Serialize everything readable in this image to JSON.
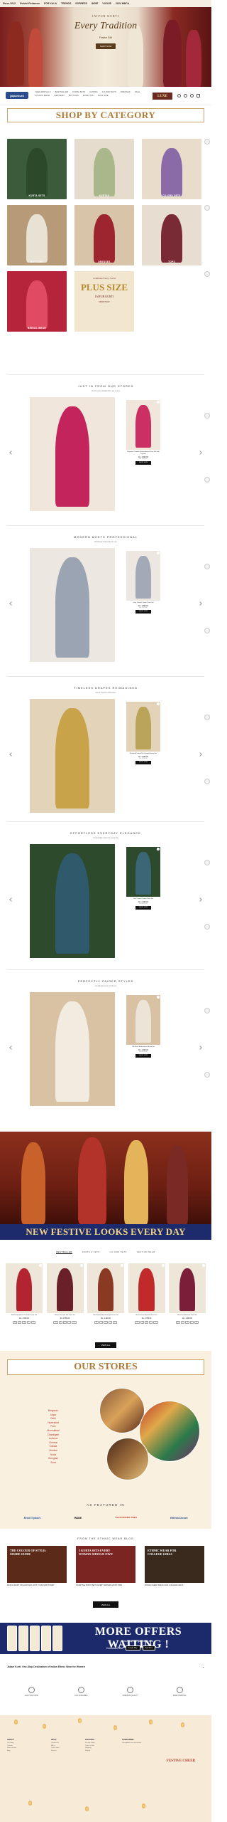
{
  "ticker": [
    "Since 2012",
    "Rohini Firdamon",
    "FOR KALA",
    "TRENDS",
    "EXPRESS",
    "INDIE",
    "VOGUE",
    "2024 MBCA"
  ],
  "hero": {
    "logo": "JAIPUR KURTI",
    "title": "Every Tradition",
    "subtitle": "Festive Edit",
    "cta": "SHOP NOW"
  },
  "nav": {
    "brand": "jaipurkurti",
    "links": [
      "NEW ARRIVALS",
      "BESTSELLER",
      "KURTA SETS",
      "KURTAS",
      "CO-ORD SETS",
      "DRESSES",
      "SALE",
      "ETHNIC WEAR",
      "WESTERN",
      "BOTTOMS",
      "DUPATTAS",
      "PLUS SIZE"
    ],
    "luxe": "LUXE",
    "icons": [
      "search-icon",
      "account-icon",
      "wishlist-icon",
      "cart-icon"
    ]
  },
  "shop_by_category": {
    "title": "SHOP BY CATEGORY",
    "items": [
      {
        "label": "KURTA SETS",
        "bg": "#3b5b3a",
        "fg": "#2c4a2a"
      },
      {
        "label": "KURTAS",
        "bg": "#e6dccd",
        "fg": "#a9b78a"
      },
      {
        "label": "CO-ORD SETS",
        "bg": "#e9dccb",
        "fg": "#8b6aa8"
      },
      {
        "label": "BOTTOMS",
        "bg": "#b79a78",
        "fg": "#e8e2d5"
      },
      {
        "label": "DRESSES",
        "bg": "#d8c4a8",
        "fg": "#9c2530"
      },
      {
        "label": "TOPS",
        "bg": "#e7ddd0",
        "fg": "#7a2a35"
      },
      {
        "label": "BRIDAL WEAR",
        "bg": "#b5243b",
        "fg": "#e04a62"
      }
    ],
    "plus_size": {
      "t1": "Celebrate Every Curve",
      "t2": "PLUS SIZE",
      "t3": "JAIPUR KURTI",
      "t4": "SHOP NOW"
    }
  },
  "featured_sections": [
    {
      "title": "JUST IN FROM OUR STORES",
      "subtitle": "Fresh styles straight from our stores",
      "product": "Magenta Chanderi Embroidered Kurta Set with Dupatta",
      "price": "Rs. 3,899.00",
      "mrp": "Rs. 6,499.00",
      "btn": "SHOP NOW",
      "bg": "#f1e6dc",
      "main_color": "#c2245b",
      "card_color": "#cb2f63"
    },
    {
      "title": "MODERN MEETS PROFESSIONAL",
      "subtitle": "Workwear that works for you",
      "product": "Grey Printed Cotton Kurta Set",
      "price": "Rs. 1,899.00",
      "mrp": "Rs. 3,199.00",
      "btn": "SHOP NOW",
      "bg": "#ece7e0",
      "main_color": "#9aa4b2",
      "card_color": "#a2aab8"
    },
    {
      "title": "TIMELESS DRAPES REIMAGINED",
      "subtitle": "Saree-inspired silhouettes",
      "product": "Mustard Printed Pre-Draped Saree Set",
      "price": "Rs. 4,299.00",
      "mrp": "Rs. 6,999.00",
      "btn": "SHOP NOW",
      "bg": "#e3d3b8",
      "main_color": "#c9a34a",
      "card_color": "#b9a45a"
    },
    {
      "title": "EFFORTLESS EVERYDAY ELEGANCE",
      "subtitle": "Comfortable styles for every day",
      "product": "Teal Printed Cotton Kurta Set",
      "price": "Rs. 2,199.00",
      "mrp": "Rs. 3,699.00",
      "btn": "SHOP NOW",
      "bg": "#2d4a2c",
      "main_color": "#2f5a6b",
      "card_color": "#3a6676"
    },
    {
      "title": "PERFECTLY PAIRED STYLES",
      "subtitle": "Coordinated sets you'll love",
      "product": "Off White Embroidered Kurta Set",
      "price": "Rs. 3,499.00",
      "mrp": "Rs. 5,799.00",
      "btn": "SHOP NOW",
      "bg": "#d9c2a3",
      "main_color": "#f1ebe0",
      "card_color": "#ece4d6"
    }
  ],
  "new_festive": {
    "title": "NEW FESTIVE LOOKS EVERY DAY",
    "tabs": [
      "BESTSELLER",
      "KURTA & SETS",
      "CO-ORD SETS",
      "FESTIVE WEAR"
    ],
    "products": [
      {
        "name": "Red Embroidered Chanderi Kurta Set",
        "price": "Rs. 3,599.00",
        "color": "#b32431"
      },
      {
        "name": "Maroon Printed Silk Kurta Set",
        "price": "Rs. 2,899.00",
        "color": "#6a2028"
      },
      {
        "name": "Rust Embroidered Straight Kurta Set",
        "price": "Rs. 3,199.00",
        "color": "#8a3a22"
      },
      {
        "name": "Red Printed Anarkali Kurta Set",
        "price": "Rs. 2,799.00",
        "color": "#c02a2a"
      },
      {
        "name": "Wine Embroidered Kurta Set",
        "price": "Rs. 3,399.00",
        "color": "#7a1e3a"
      }
    ],
    "sizes": [
      "XS",
      "S",
      "M",
      "L",
      "XL"
    ],
    "view_all": "VIEW ALL"
  },
  "our_stores": {
    "title": "OUR STORES",
    "cities": [
      "Bengaluru",
      "Jaipur",
      "Delhi",
      "Hyderabad",
      "Pune",
      "Ahmedabad",
      "Chandigarh",
      "Lucknow",
      "Chennai",
      "Kolkata",
      "Mumbai",
      "Noida",
      "Gurugram",
      "Surat"
    ]
  },
  "featured_in": {
    "title": "AS FEATURED IN",
    "logos": [
      "Retail Updates",
      "INDIE",
      "THE ECONOMIC TIMES",
      "EthnicCloset"
    ]
  },
  "blog": {
    "title": "FROM THE ETHNIC WEAR BLOG",
    "posts": [
      {
        "img_text": "THE COLOUR OF STYLE: SHADE GUIDE",
        "name": "WHICH SHIRT COLOUR WILL SUIT YOUR SKIN TONE?",
        "bg": "#5b2a18"
      },
      {
        "img_text": "5 KURTA SETS EVERY WOMAN SHOULD OWN",
        "name": "5 FESTIVE KURTA SETS EVERY WOMAN MUST OWN",
        "bg": "#7a2521"
      },
      {
        "img_text": "ETHNIC WEAR FOR COLLEGE GIRLS",
        "name": "ETHNIC WEAR IDEAS FOR COLLEGE GIRLS",
        "bg": "#3a2a1e"
      }
    ],
    "view_all": "VIEW ALL"
  },
  "offers": {
    "title": "MORE OFFERS WAITING !",
    "subtitle": "Shop the app, jaipurkurti.com",
    "download": "Download Now",
    "stores": [
      "Google Play",
      "App Store"
    ]
  },
  "accordion": "Jaipur Kurti: One-Stop Destination of Indian Ethnic Wear for Women",
  "usps": [
    {
      "icon": "return-icon",
      "label": "EASY RETURNS"
    },
    {
      "icon": "cod-icon",
      "label": "COD AVAILABLE"
    },
    {
      "icon": "quality-icon",
      "label": "PREMIUM QUALITY"
    },
    {
      "icon": "shipping-icon",
      "label": "FREE SHIPPING"
    }
  ],
  "footer": {
    "cols": [
      {
        "title": "ABOUT",
        "items": [
          "Our Story",
          "Careers",
          "Store Locator",
          "Blog"
        ]
      },
      {
        "title": "HELP",
        "items": [
          "Contact Us",
          "FAQs",
          "Track Order",
          "Returns"
        ]
      },
      {
        "title": "POLICIES",
        "items": [
          "Privacy Policy",
          "Terms of Use",
          "Shipping",
          "Refund"
        ]
      },
      {
        "title": "SUBSCRIBE",
        "items": [
          "Get updates on new arrivals"
        ]
      }
    ],
    "festive": "FESTIVE CHEER"
  }
}
